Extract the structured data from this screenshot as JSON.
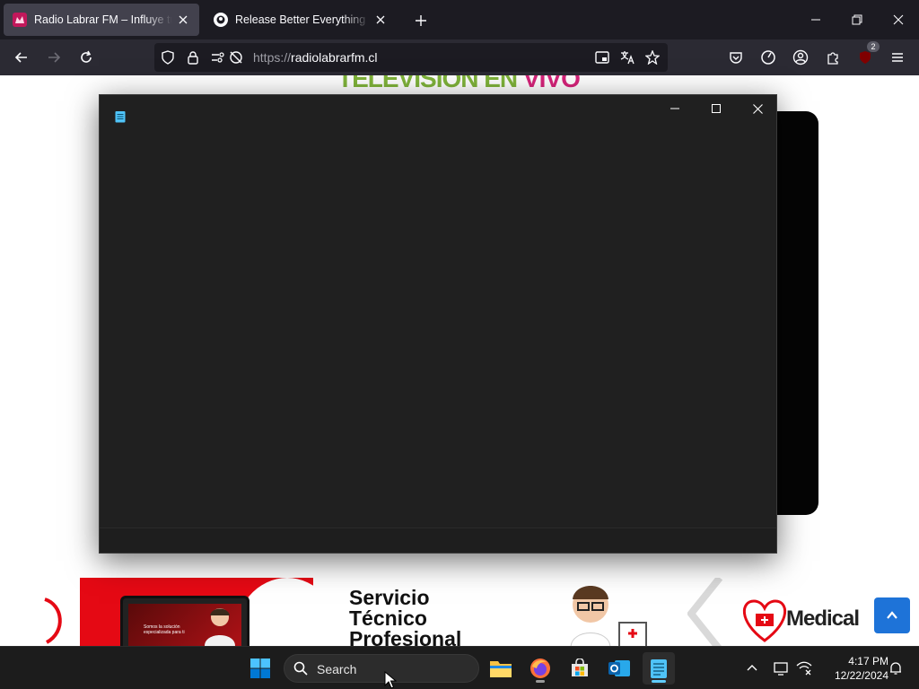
{
  "browser": {
    "tabs": [
      {
        "title": "Radio Labrar FM – Influye tus se",
        "active": true
      },
      {
        "title": "Release Better Everything + hot",
        "active": false
      }
    ],
    "url_scheme": "https://",
    "url_host": "radiolabrarfm.cl",
    "extension_badge": "2"
  },
  "page": {
    "headline_green": "TELEVISION EN",
    "headline_pink": "VIVO",
    "service_line1": "Servicio",
    "service_line2": "Técnico",
    "service_line3": "Profesional",
    "laptop_text": "Somos la solución especializada para ti",
    "medical_text": "Medical"
  },
  "taskbar": {
    "search_label": "Search",
    "time": "4:17 PM",
    "date": "12/22/2024"
  },
  "colors": {
    "accent_blue": "#1e73d8",
    "headline_green": "#7fb33a",
    "headline_pink": "#d6237a",
    "banner_red": "#e50914"
  }
}
